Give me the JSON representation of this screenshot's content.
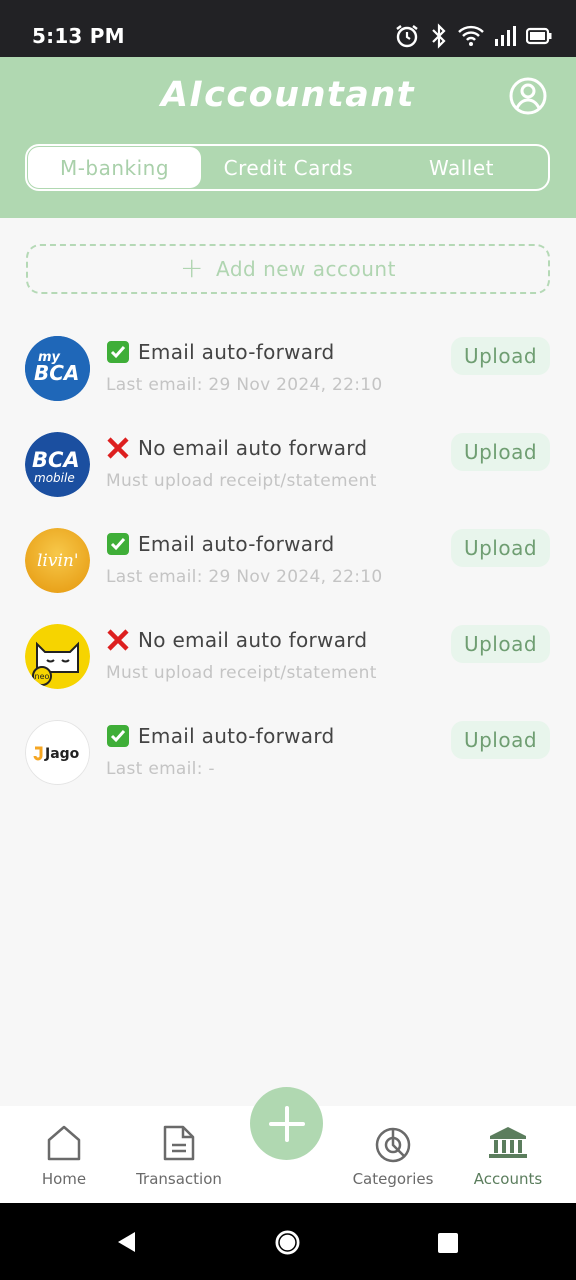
{
  "status_bar": {
    "time": "5:13 PM",
    "icons": [
      "alarm-icon",
      "bluetooth-icon",
      "wifi-icon",
      "signal-icon",
      "battery-icon"
    ]
  },
  "header": {
    "title": "AIccountant",
    "profile_icon": "profile-icon",
    "tabs": [
      {
        "label": "M-banking",
        "active": true
      },
      {
        "label": "Credit Cards",
        "active": false
      },
      {
        "label": "Wallet",
        "active": false
      }
    ]
  },
  "add_account": {
    "label": "Add new account",
    "icon": "plus-icon"
  },
  "accounts": [
    {
      "logo": "mybca-logo",
      "logo_text_top": "my",
      "logo_text_main": "BCA",
      "status_icon": "check-icon",
      "status": "Email auto-forward",
      "sub": "Last email: 29 Nov 2024, 22:10",
      "action": "Upload"
    },
    {
      "logo": "bca-mobile-logo",
      "logo_text_main": "BCA",
      "logo_text_bottom": "mobile",
      "status_icon": "cross-icon",
      "status": "No email auto forward",
      "sub": "Must upload receipt/statement",
      "action": "Upload"
    },
    {
      "logo": "livin-logo",
      "logo_text_main": "livin'",
      "status_icon": "check-icon",
      "status": "Email auto-forward",
      "sub": "Last email: 29 Nov 2024, 22:10",
      "action": "Upload"
    },
    {
      "logo": "neo-logo",
      "logo_text_main": "neo",
      "status_icon": "cross-icon",
      "status": "No email auto forward",
      "sub": "Must upload receipt/statement",
      "action": "Upload"
    },
    {
      "logo": "jago-logo",
      "logo_text_main": "Jago",
      "status_icon": "check-icon",
      "status": "Email auto-forward",
      "sub": "Last email: -",
      "action": "Upload"
    }
  ],
  "bottom_nav": {
    "items": [
      {
        "label": "Home",
        "icon": "home-icon",
        "active": false
      },
      {
        "label": "Transaction",
        "icon": "document-icon",
        "active": false
      },
      {
        "label": "Categories",
        "icon": "pie-chart-icon",
        "active": false
      },
      {
        "label": "Accounts",
        "icon": "bank-icon",
        "active": true
      }
    ],
    "fab_icon": "plus-icon"
  },
  "android_nav": [
    "back-icon",
    "home-circle-icon",
    "recents-icon"
  ],
  "colors": {
    "header": "#b0d8b1",
    "accent_text": "#6f9e72",
    "upload_bg": "#e8f5ec",
    "active_nav": "#5b7d5d",
    "check": "#3fae38",
    "cross": "#dd1f1f"
  }
}
